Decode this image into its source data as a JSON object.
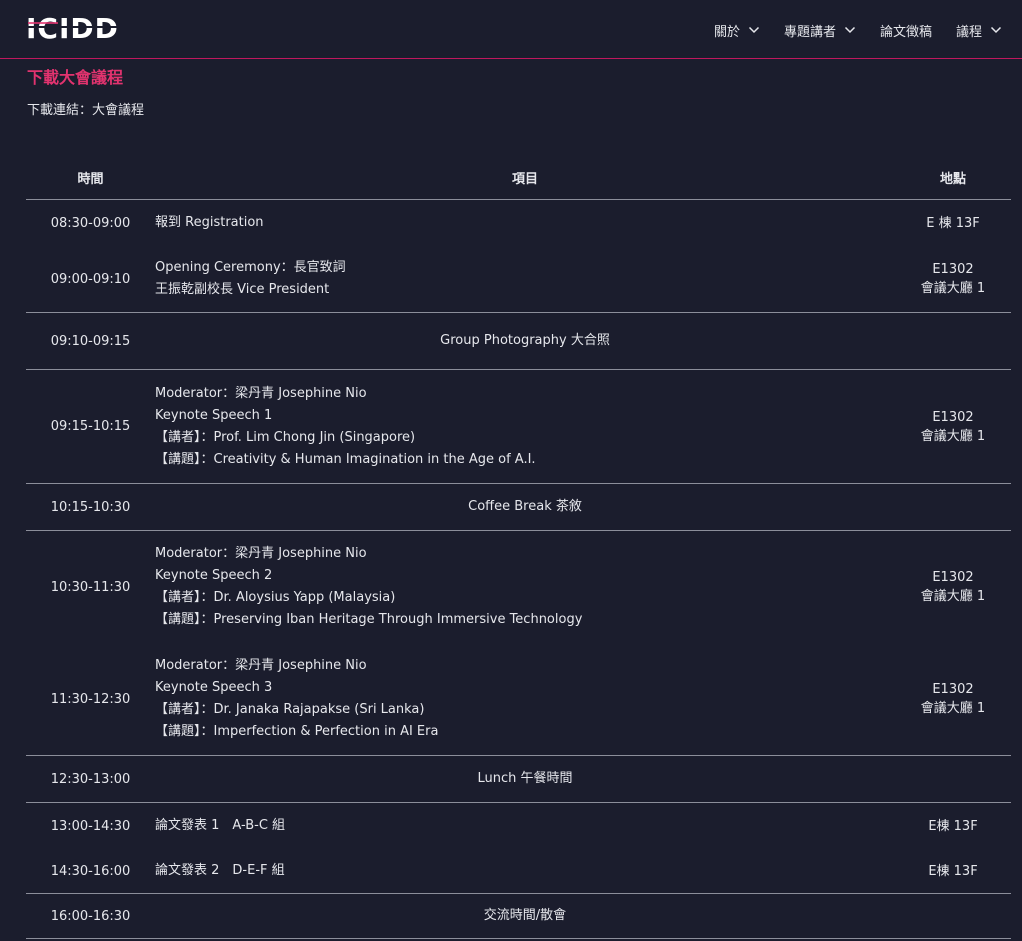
{
  "brand": {
    "logo_text": "ICIDD"
  },
  "colors": {
    "background": "#1b1d2d",
    "accent": "#e2336f",
    "divider": "#8c8e9a"
  },
  "nav": [
    {
      "label": "關於",
      "has_dropdown": true
    },
    {
      "label": "專題講者",
      "has_dropdown": true
    },
    {
      "label": "論文徵稿",
      "has_dropdown": false
    },
    {
      "label": "議程",
      "has_dropdown": true
    }
  ],
  "page": {
    "title": "下載大會議程",
    "download_prefix": "下載連結：",
    "download_link": "大會議程"
  },
  "table": {
    "headers": {
      "time": "時間",
      "item": "項目",
      "place": "地點"
    },
    "groups": [
      {
        "rows": [
          {
            "time": "08:30-09:00",
            "item": [
              "報到 Registration"
            ],
            "place": [
              "E 棟 13F"
            ]
          },
          {
            "time": "09:00-09:10",
            "item": [
              "Opening Ceremony：長官致詞",
              "王振乾副校長 Vice President"
            ],
            "place": [
              "E1302",
              "會議大廳 1"
            ]
          }
        ]
      },
      {
        "rows": [
          {
            "time": "09:10-09:15",
            "item": [
              "Group Photography 大合照"
            ],
            "center": true,
            "place": []
          }
        ]
      },
      {
        "rows": [
          {
            "time": "09:15-10:15",
            "item": [
              "Moderator：梁丹青 Josephine Nio",
              "Keynote Speech 1",
              "【講者】：Prof. Lim Chong Jin (Singapore)",
              "【講題】：Creativity & Human Imagination in the Age of A.I."
            ],
            "place": [
              "E1302",
              "會議大廳 1"
            ]
          }
        ]
      },
      {
        "rows": [
          {
            "time": "10:15-10:30",
            "item": [
              "Coffee Break 茶敘"
            ],
            "center": true,
            "place": []
          }
        ]
      },
      {
        "rows": [
          {
            "time": "10:30-11:30",
            "item": [
              "Moderator：梁丹青 Josephine Nio",
              "Keynote Speech 2",
              "【講者】：Dr. Aloysius Yapp (Malaysia)",
              "【講題】：Preserving Iban Heritage Through Immersive Technology"
            ],
            "place": [
              "E1302",
              "會議大廳 1"
            ]
          },
          {
            "time": "11:30-12:30",
            "item": [
              "Moderator：梁丹青 Josephine Nio",
              "Keynote Speech 3",
              "【講者】：Dr. Janaka Rajapakse (Sri Lanka)",
              "【講題】：Imperfection & Perfection in AI Era"
            ],
            "place": [
              "E1302",
              "會議大廳 1"
            ]
          }
        ]
      },
      {
        "rows": [
          {
            "time": "12:30-13:00",
            "item": [
              "Lunch 午餐時間"
            ],
            "center": true,
            "place": []
          }
        ]
      },
      {
        "rows": [
          {
            "time": "13:00-14:30",
            "item": [
              "論文發表 1　A-B-C 組"
            ],
            "place": [
              "E棟 13F"
            ]
          },
          {
            "time": "14:30-16:00",
            "item": [
              "論文發表 2　D-E-F 組"
            ],
            "place": [
              "E棟 13F"
            ]
          }
        ]
      },
      {
        "rows": [
          {
            "time": "16:00-16:30",
            "item": [
              "交流時間/散會"
            ],
            "center": true,
            "place": []
          }
        ]
      }
    ]
  }
}
